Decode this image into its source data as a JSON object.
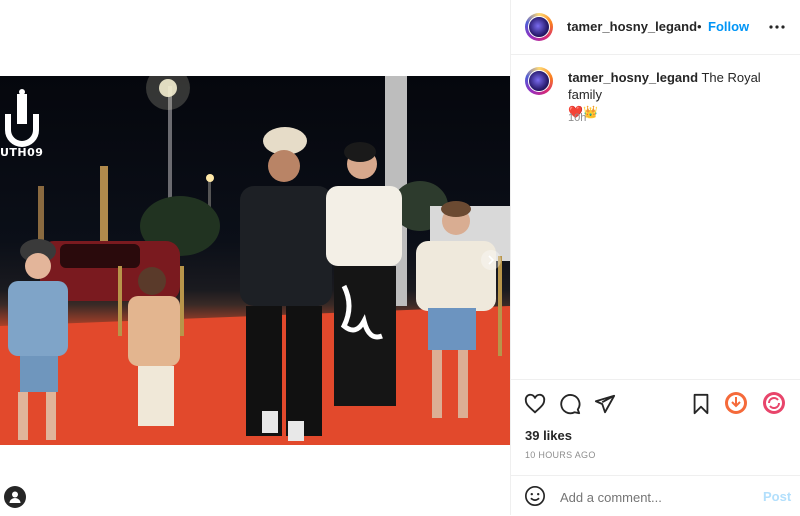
{
  "post": {
    "username": "tamer_hosny_legand",
    "follow_label": "Follow",
    "separator": "•",
    "caption_text": "The Royal family",
    "caption_emoji": "❤️👑",
    "caption_time": "10h",
    "likes": "39 likes",
    "posted_ago": "10 HOURS AGO",
    "watermark_text": "UTH09"
  },
  "comment": {
    "placeholder": "Add a comment...",
    "post_label": "Post"
  },
  "colors": {
    "accent": "#0095f6",
    "post_disabled": "#b2dffc",
    "muted": "#8e8e8e"
  },
  "icons": [
    "heart-icon",
    "comment-icon",
    "share-icon",
    "bookmark-icon",
    "pin-icon",
    "repost-icon",
    "emoji-icon",
    "more-icon",
    "user-icon",
    "chevron-right-icon"
  ]
}
